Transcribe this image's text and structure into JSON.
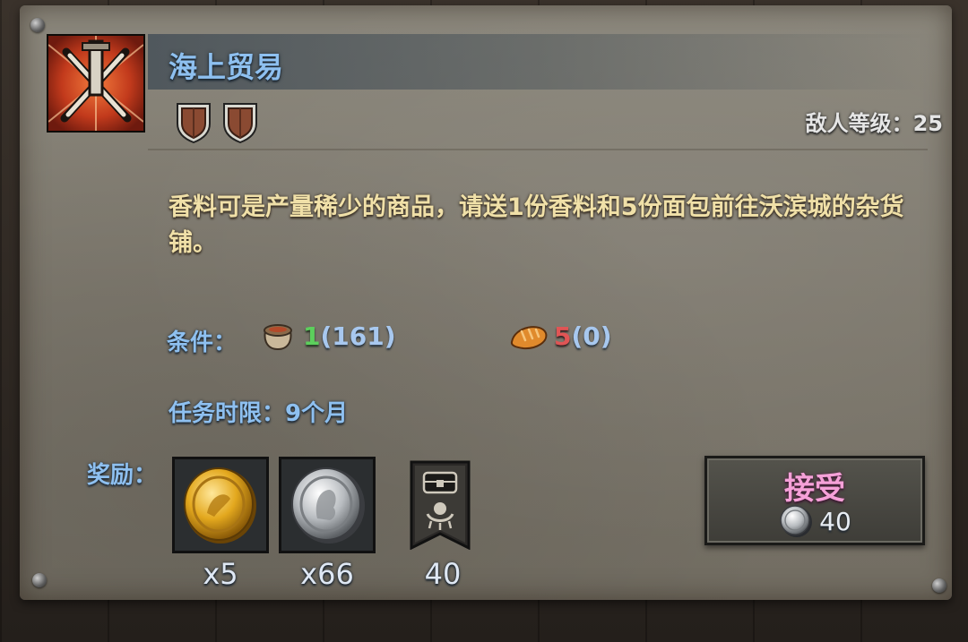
{
  "quest": {
    "title": "海上贸易",
    "icon": "crossed-swords-icon",
    "difficulty_shields": 2,
    "enemy_level_label": "敌人等级：25",
    "description": "香料可是产量稀少的商品，请送1份香料和5份面包前往沃滨城的杂货铺。"
  },
  "conditions": {
    "label": "条件：",
    "items": [
      {
        "icon": "spice-sack-icon",
        "required": "1",
        "owned": "(161)",
        "status": "met"
      },
      {
        "icon": "bread-icon",
        "required": "5",
        "owned": "(0)",
        "status": "unmet"
      }
    ]
  },
  "time_limit": {
    "label": "任务时限：9个月"
  },
  "rewards": {
    "label": "奖励：",
    "items": [
      {
        "icon": "gold-coin-icon",
        "count": "x5"
      },
      {
        "icon": "silver-coin-icon",
        "count": "x66"
      },
      {
        "icon": "chest-banner-icon",
        "count": "40"
      }
    ]
  },
  "accept_button": {
    "label": "接受",
    "cost_icon": "silver-coin-icon",
    "cost": "40"
  },
  "colors": {
    "title_blue": "#8ec0f0",
    "description_gold": "#f0e0a8",
    "met_green": "#5ccf5c",
    "unmet_red": "#e05555",
    "accept_pink": "#f5a0d8"
  }
}
